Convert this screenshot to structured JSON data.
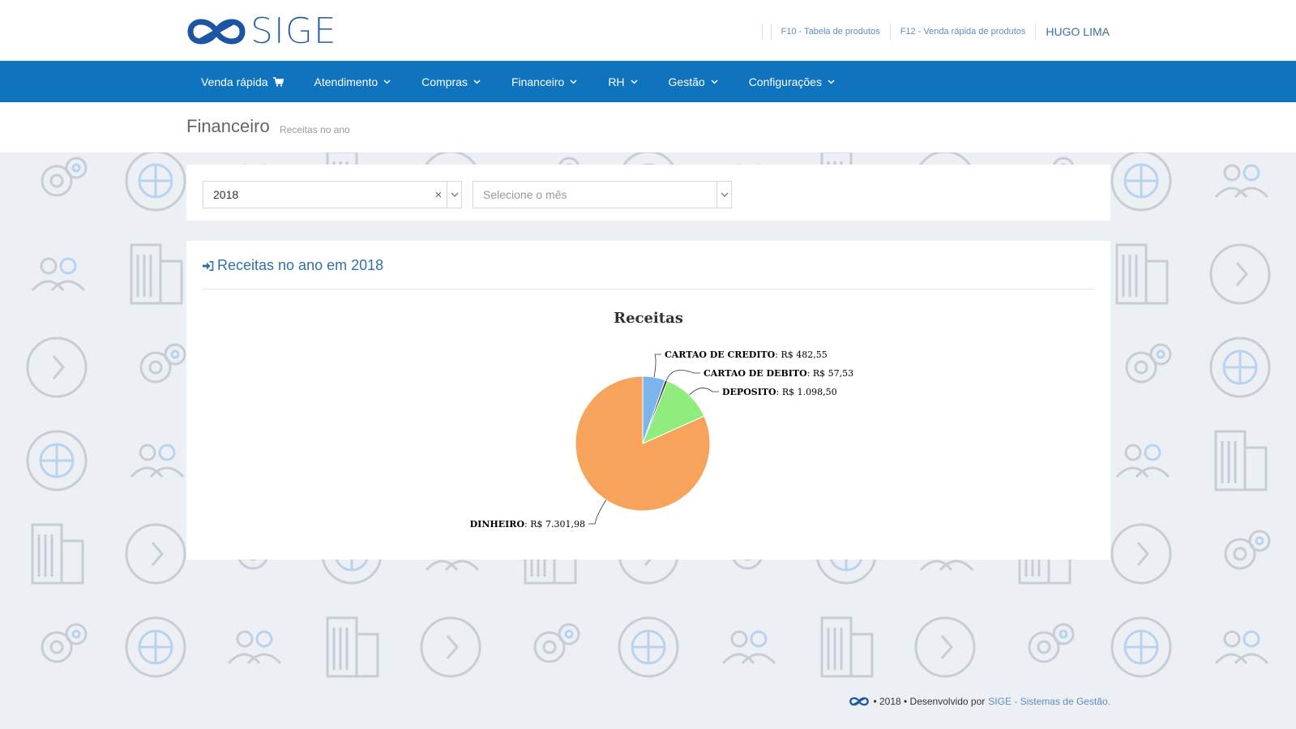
{
  "brand": {
    "name": "SIGE",
    "color": "#1c56a3"
  },
  "top_links": [
    {
      "label": "F10 - Tabela de produtos"
    },
    {
      "label": "F12 - Venda rápida de produtos"
    }
  ],
  "user": {
    "name": "HUGO LIMA"
  },
  "nav": {
    "items": [
      {
        "label": "Venda rápida",
        "icon": "cart-icon"
      },
      {
        "label": "Atendimento",
        "icon": "chevron-down-icon"
      },
      {
        "label": "Compras",
        "icon": "chevron-down-icon"
      },
      {
        "label": "Financeiro",
        "icon": "chevron-down-icon"
      },
      {
        "label": "RH",
        "icon": "chevron-down-icon"
      },
      {
        "label": "Gestão",
        "icon": "chevron-down-icon"
      },
      {
        "label": "Configurações",
        "icon": "chevron-down-icon"
      }
    ],
    "color": "#0f73bd"
  },
  "page": {
    "title": "Financeiro",
    "subtitle": "Receitas no ano"
  },
  "filters": {
    "year": {
      "value": "2018"
    },
    "month": {
      "placeholder": "Selecione o mês"
    }
  },
  "panel": {
    "title": "Receitas no ano em 2018",
    "icon": "sign-in-icon"
  },
  "chart_data": {
    "type": "pie",
    "title": "Receitas",
    "slices": [
      {
        "name": "CARTAO DE CREDITO",
        "value": 482.55,
        "label": "R$ 482,55",
        "color": "#7cb5ec"
      },
      {
        "name": "CARTAO DE DEBITO",
        "value": 57.53,
        "label": "R$ 57,53",
        "color": "#434348"
      },
      {
        "name": "DEPOSITO",
        "value": 1098.5,
        "label": "R$ 1.098,50",
        "color": "#90ed7d"
      },
      {
        "name": "DINHEIRO",
        "value": 7301.98,
        "label": "R$ 7.301,98",
        "color": "#f7a35c"
      }
    ]
  },
  "footer": {
    "text": "• 2018 • Desenvolvido por",
    "link": "SIGE - Sistemas de Gestão."
  }
}
